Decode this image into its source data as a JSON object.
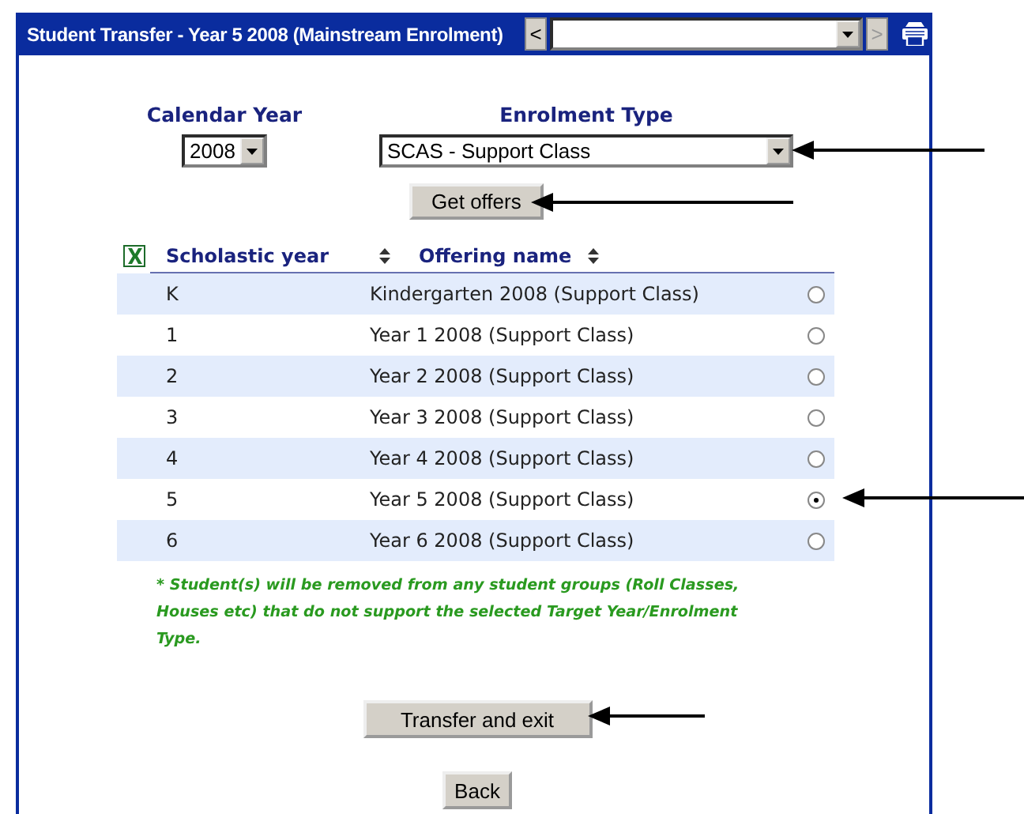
{
  "window": {
    "title": "Student Transfer - Year 5 2008 (Mainstream Enrolment)"
  },
  "navigation": {
    "prev": {
      "label": "<",
      "disabled": false
    },
    "next": {
      "label": ">",
      "disabled": true
    }
  },
  "calendar_year": {
    "label": "Calendar Year",
    "value": "2008"
  },
  "enrolment_type": {
    "label": "Enrolment Type",
    "value": "SCAS - Support Class"
  },
  "get_offers_button": "Get offers",
  "table": {
    "columns": [
      "Scholastic year",
      "Offering name"
    ],
    "rows": [
      {
        "year": "K",
        "offering": "Kindergarten 2008 (Support Class)",
        "selected": false
      },
      {
        "year": "1",
        "offering": "Year 1 2008 (Support Class)",
        "selected": false
      },
      {
        "year": "2",
        "offering": "Year 2 2008 (Support Class)",
        "selected": false
      },
      {
        "year": "3",
        "offering": "Year 3 2008 (Support Class)",
        "selected": false
      },
      {
        "year": "4",
        "offering": "Year 4 2008 (Support Class)",
        "selected": false
      },
      {
        "year": "5",
        "offering": "Year 5 2008 (Support Class)",
        "selected": true
      },
      {
        "year": "6",
        "offering": "Year 6 2008 (Support Class)",
        "selected": false
      }
    ]
  },
  "note": "* Student(s) will be removed from any student groups (Roll Classes, Houses etc) that do not support the selected Target Year/Enrolment Type.",
  "buttons": [
    "Transfer and exit",
    "Back"
  ]
}
